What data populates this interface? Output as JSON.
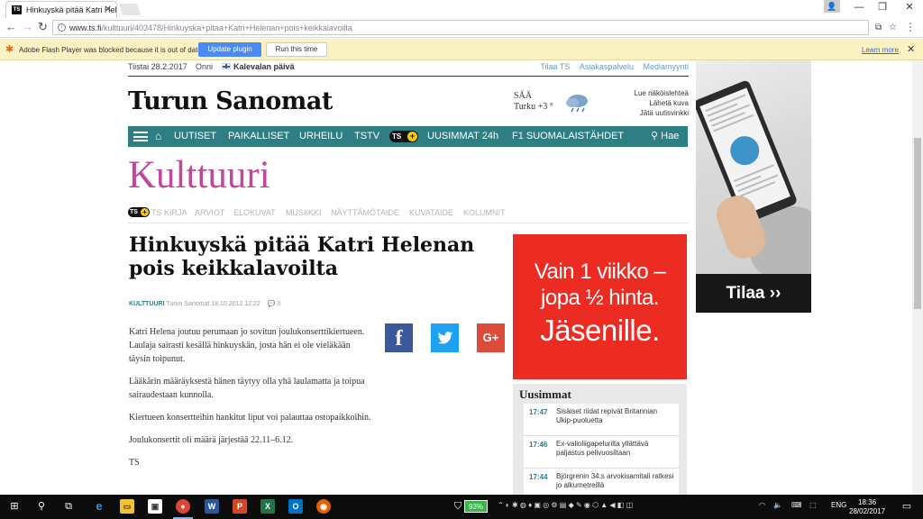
{
  "browser": {
    "tab_title": "Hinkuyskä pitää Katri Hel",
    "tab_favicon": "TS",
    "url_host": "www.ts.fi",
    "url_path": "/kulttuuri/403478/Hinkuyska+pitaa+Katri+Helenan+pois+keikkalavoilta",
    "flash_message": "Adobe Flash Player was blocked because it is out of date.",
    "flash_update": "Update plugin",
    "flash_run": "Run this time",
    "flash_learn": "Learn more"
  },
  "site": {
    "date": "Tiistai 28.2.2017",
    "nameday": "Onni",
    "flagday": "Kalevalan päivä",
    "top_links": [
      "Tilaa TS",
      "Asiakaspalvelu",
      "Mediamyynti"
    ],
    "logo": "Turun Sanomat",
    "weather_label": "SÄÄ",
    "weather_value": "Turku +3 °",
    "side_links": [
      "Lue näköislehteä",
      "Lähetä kuva",
      "Jätä uutisvinkki"
    ],
    "nav": [
      "UUTISET",
      "PAIKALLISET",
      "URHEILU",
      "TSTV",
      "UUSIMMAT 24h",
      "F1 SUOMALAISTÄHDET"
    ],
    "nav_ts": "TS",
    "nav_search": "Hae",
    "section": "Kulttuuri",
    "subnav": [
      "TS KIRJA",
      "ARVIOT",
      "ELOKUVAT",
      "MUSIIKKI",
      "NÄYTTÄMÖTAIDE",
      "KUVATAIDE",
      "KOLUMNIT"
    ]
  },
  "article": {
    "headline": "Hinkuyskä pitää Katri Helenan pois keikkalavoilta",
    "category": "KULTTUURI",
    "source": "Turun Sanomat",
    "timestamp": "18.10.2012 12:22",
    "comments": "0",
    "paragraphs": [
      "Katri Helena joutuu perumaan jo sovitun joulukonserttikiertueen. Laulaja sairasti kesällä hinkuyskän, josta hän ei ole vieläkään täysin toipunut.",
      "Lääkärin määräyksestä hänen täytyy olla yhä laulamatta ja toipua sairaudestaan kunnolla.",
      "Kiertueen konsertteihin hankitut liput voi palauttaa ostopaikkoihin.",
      "Joulukonsertit oli määrä järjestää 22.11–6.12.",
      "TS"
    ]
  },
  "ad_red": {
    "line1": "Vain 1 viikko –",
    "line2": "jopa ½ hinta.",
    "line3": "Jäsenille."
  },
  "ad_side": {
    "cta": "Tilaa ››"
  },
  "latest": {
    "title": "Uusimmat",
    "items": [
      {
        "time": "17:47",
        "headline": "Sisäiset riidat repivät Britannian Ukip-puoluetta"
      },
      {
        "time": "17:46",
        "headline": "Ex-valioliigapelurilta yllättävä paljastus pelivuosiltaan"
      },
      {
        "time": "17:44",
        "headline": "Björgrenin 34:s arvokisamitali ratkesi jo alkumetreillä"
      }
    ]
  },
  "taskbar": {
    "battery": "93%",
    "lang": "ENG",
    "time": "18:36",
    "date": "28/02/2017"
  },
  "colors": {
    "nav_teal": "#2f7e84",
    "section_pink": "#c0479a",
    "ad_red": "#ec2c23"
  }
}
